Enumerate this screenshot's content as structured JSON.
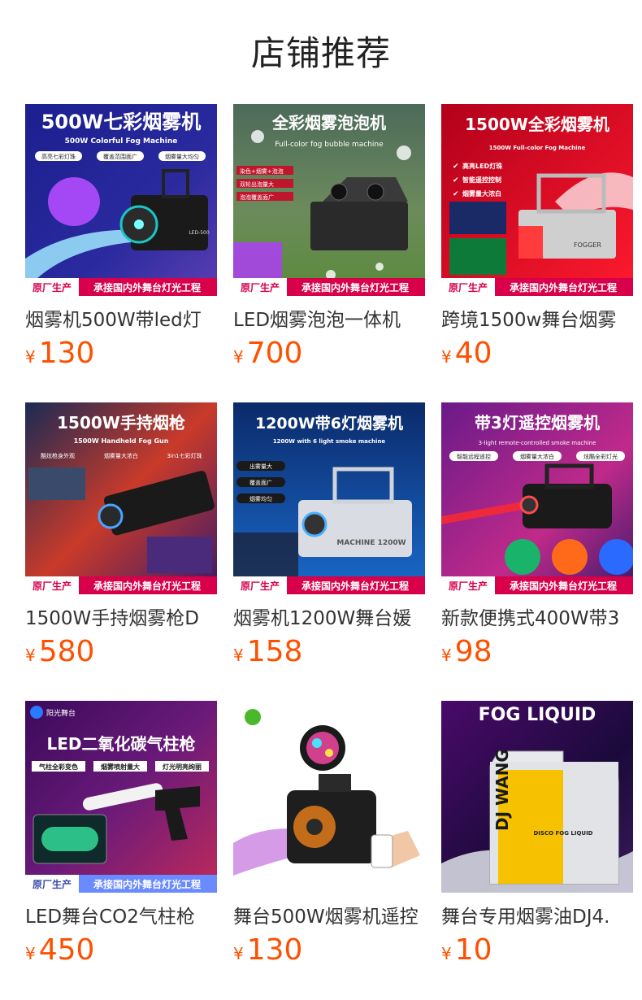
{
  "page": {
    "title": "店铺推荐"
  },
  "currency_symbol": "¥",
  "colors": {
    "price": "#ff5000",
    "text": "#333333"
  },
  "products": [
    {
      "name": "烟雾机500W带led灯",
      "price": "130",
      "image": {
        "headline": "500W七彩烟雾机",
        "subline": "500W Colorful Fog Machine",
        "tags": [
          "高亮七彩灯珠",
          "覆盖范围面广",
          "烟雾量大均匀"
        ],
        "badge": "原厂生产",
        "footer": "承接国内外舞台灯光工程",
        "model": "LED-500"
      }
    },
    {
      "name": "LED烟雾泡泡一体机",
      "price": "700",
      "image": {
        "headline": "全彩烟雾泡泡机",
        "subline": "Full-color fog bubble machine",
        "tags": [
          "染色+烟雾+泡泡",
          "双轮出泡量大",
          "泡泡覆盖面广"
        ],
        "badge": "原厂生产",
        "footer": "承接国内外舞台灯光工程"
      }
    },
    {
      "name": "跨境1500w舞台烟雾",
      "price": "40",
      "image": {
        "headline": "1500W全彩烟雾机",
        "subline": "1500W Full-color Fog Machine",
        "tags": [
          "高亮LED灯珠",
          "智能遥控控制",
          "烟雾量大浓白"
        ],
        "badge": "原厂生产",
        "footer": "承接国内外舞台灯光工程",
        "model": "FOGGER"
      }
    },
    {
      "name": "1500W手持烟雾枪D",
      "price": "580",
      "image": {
        "headline": "1500W手持烟枪",
        "subline": "1500W Handheld Fog Gun",
        "tags": [
          "酷炫枪身外观",
          "烟雾量大浓白",
          "3in1七彩灯珠"
        ],
        "badge": "原厂生产",
        "footer": "承接国内外舞台灯光工程"
      }
    },
    {
      "name": "烟雾机1200W舞台媛",
      "price": "158",
      "image": {
        "headline": "1200W带6灯烟雾机",
        "subline": "1200W with 6 light smoke machine",
        "tags": [
          "出雾量大",
          "覆盖面广",
          "烟雾均匀"
        ],
        "badge": "原厂生产",
        "footer": "承接国内外舞台灯光工程",
        "model": "MACHINE 1200W"
      }
    },
    {
      "name": "新款便携式400W带3",
      "price": "98",
      "image": {
        "headline": "带3灯遥控烟雾机",
        "subline": "3-light remote-controlled smoke machine",
        "tags": [
          "智能远程遥控",
          "烟雾量大浓白",
          "炫酷全彩灯光"
        ],
        "badge": "原厂生产",
        "footer": "承接国内外舞台灯光工程"
      }
    },
    {
      "name": "LED舞台CO2气柱枪",
      "price": "450",
      "image": {
        "brand": "阳光舞台",
        "headline": "LED二氧化碳气柱枪",
        "tags": [
          "气柱全彩变色",
          "烟雾喷射量大",
          "灯光明亮绚丽"
        ],
        "badge": "原厂生产",
        "footer": "承接国内外舞台灯光工程"
      }
    },
    {
      "name": "舞台500W烟雾机遥控",
      "price": "130",
      "image": {}
    },
    {
      "name": "舞台专用烟雾油DJ4.",
      "price": "10",
      "image": {
        "headline": "FOG LIQUID",
        "brand": "DJ WANG",
        "label": "DISCO FOG LIQUID"
      }
    }
  ]
}
